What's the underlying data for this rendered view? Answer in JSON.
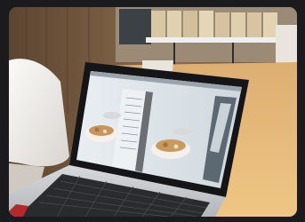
{
  "scene": {
    "subject": "laptop",
    "screen_app": "photo-editor",
    "laptop_brand": "",
    "colors": {
      "wall": "#7a5e45",
      "table": "#e6b778",
      "chair": "#f1efec",
      "laptop_body": "#c9cbce",
      "keyboard": "#2a2b2e",
      "screen_bezel": "#151517"
    }
  }
}
